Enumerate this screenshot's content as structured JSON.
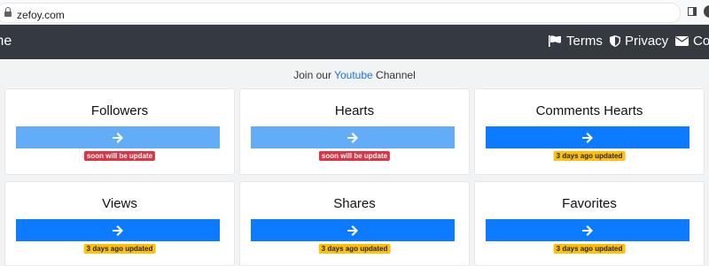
{
  "browser": {
    "url": "zefoy.com"
  },
  "navbar": {
    "brand": "me",
    "links": [
      {
        "label": "Terms",
        "icon": "flag-icon"
      },
      {
        "label": "Privacy",
        "icon": "shield-icon"
      },
      {
        "label": "Con",
        "icon": "envelope-icon"
      }
    ]
  },
  "join": {
    "prefix": "Join our",
    "link": "Youtube",
    "suffix": "Channel"
  },
  "cards": [
    {
      "title": "Followers",
      "status": "soon will be update",
      "status_color": "#dc3545",
      "button_color": "#63adf8"
    },
    {
      "title": "Hearts",
      "status": "soon will be update",
      "status_color": "#dc3545",
      "button_color": "#63adf8"
    },
    {
      "title": "Comments Hearts",
      "status": "3 days ago updated",
      "status_color": "#ffc107",
      "button_color": "#0d7bff"
    },
    {
      "title": "Views",
      "status": "3 days ago updated",
      "status_color": "#ffc107",
      "button_color": "#0d7bff"
    },
    {
      "title": "Shares",
      "status": "3 days ago updated",
      "status_color": "#ffc107",
      "button_color": "#0d7bff"
    },
    {
      "title": "Favorites",
      "status": "3 days ago updated",
      "status_color": "#ffc107",
      "button_color": "#0d7bff"
    }
  ]
}
